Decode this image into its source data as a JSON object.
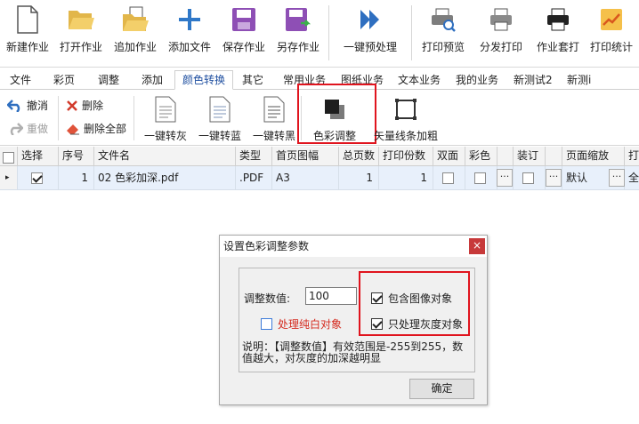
{
  "toolbar": {
    "new_job": "新建作业",
    "open_job": "打开作业",
    "append_job": "追加作业",
    "add_file": "添加文件",
    "save_job": "保存作业",
    "save_as": "另存作业",
    "one_click_preprocess": "一键预处理",
    "print_preview": "打印预览",
    "distribute_print": "分发打印",
    "job_imposition": "作业套打",
    "print_stats": "打印统计"
  },
  "tabs": [
    "文件",
    "彩页",
    "调整",
    "添加",
    "颜色转换",
    "其它",
    "常用业务",
    "图纸业务",
    "文本业务",
    "我的业务",
    "新测试2",
    "新测i"
  ],
  "active_tab": "颜色转换",
  "ribbon": {
    "undo": "撤消",
    "redo": "重做",
    "delete": "删除",
    "delete_all": "删除全部",
    "to_gray": "一键转灰",
    "to_blue": "一键转蓝",
    "to_black": "一键转黑",
    "color_adjust": "色彩调整",
    "vector_bold": "矢量线条加粗"
  },
  "grid": {
    "headers": [
      "选择",
      "序号",
      "文件名",
      "类型",
      "首页图幅",
      "总页数",
      "打印份数",
      "双面",
      "彩色",
      "装订",
      "页面缩放",
      "打"
    ],
    "row": {
      "selected": true,
      "index": "1",
      "filename": "02 色彩加深.pdf",
      "type": ".PDF",
      "first_page_size": "A3",
      "total_pages": "1",
      "copies": "1",
      "duplex": false,
      "color": false,
      "binding": false,
      "page_scale": "默认",
      "extra": "全"
    }
  },
  "dialog": {
    "title": "设置色彩调整参数",
    "close": "×",
    "adjust_label": "调整数值:",
    "adjust_value": "100",
    "pure_white_label": "处理纯白对象",
    "pure_white_checked": false,
    "include_image_label": "包含图像对象",
    "include_image_checked": true,
    "gray_only_label": "只处理灰度对象",
    "gray_only_checked": true,
    "note_line1": "说明：【调整数值】有效范围是-255到255，数",
    "note_line2": "值越大，对灰度的加深越明显",
    "ok": "确定"
  },
  "colors": {
    "highlight": "#e0141e",
    "accent": "#1f4fa0",
    "pure_white_text": "#d42a1e"
  }
}
